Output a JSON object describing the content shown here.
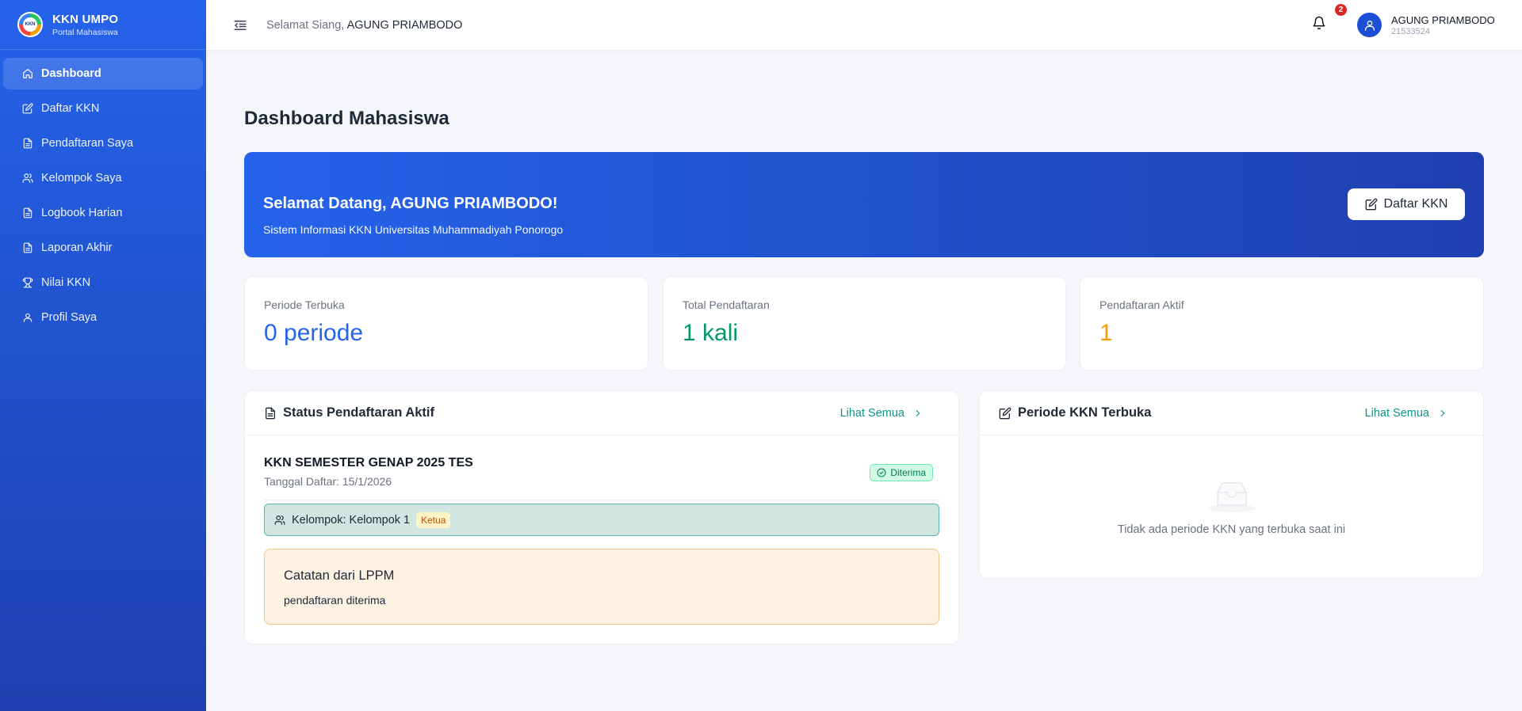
{
  "brand": {
    "title": "KKN UMPO",
    "subtitle": "Portal Mahasiswa",
    "logo_text": "KKN"
  },
  "sidebar": {
    "items": [
      {
        "label": "Dashboard",
        "icon": "home-icon",
        "active": true
      },
      {
        "label": "Daftar KKN",
        "icon": "edit-icon"
      },
      {
        "label": "Pendaftaran Saya",
        "icon": "document-icon"
      },
      {
        "label": "Kelompok Saya",
        "icon": "users-icon"
      },
      {
        "label": "Logbook Harian",
        "icon": "document-icon"
      },
      {
        "label": "Laporan Akhir",
        "icon": "document-icon"
      },
      {
        "label": "Nilai KKN",
        "icon": "trophy-icon"
      },
      {
        "label": "Profil Saya",
        "icon": "user-icon"
      }
    ]
  },
  "header": {
    "greeting_prefix": "Selamat Siang, ",
    "greeting_name": "AGUNG PRIAMBODO",
    "notification_count": "2",
    "user_name": "AGUNG PRIAMBODO",
    "user_id": "21533524"
  },
  "main": {
    "page_title": "Dashboard Mahasiswa",
    "hero": {
      "title": "Selamat Datang, AGUNG PRIAMBODO!",
      "subtitle": "Sistem Informasi KKN Universitas Muhammadiyah Ponorogo",
      "button_label": "Daftar KKN"
    },
    "stats": [
      {
        "label": "Periode Terbuka",
        "value": "0",
        "unit": "periode",
        "color": "#2563eb"
      },
      {
        "label": "Total Pendaftaran",
        "value": "1",
        "unit": "kali",
        "color": "#059669"
      },
      {
        "label": "Pendaftaran Aktif",
        "value": "1",
        "unit": "",
        "color": "#f59e0b"
      }
    ],
    "status_card": {
      "title": "Status Pendaftaran Aktif",
      "see_all": "Lihat Semua",
      "registration_name": "KKN SEMESTER GENAP 2025 TES",
      "registration_date": "Tanggal Daftar: 15/1/2026",
      "status_badge": "Diterima",
      "group_label": "Kelompok: Kelompok 1",
      "role_tag": "Ketua",
      "note_title": "Catatan dari LPPM",
      "note_text": "pendaftaran diterima"
    },
    "period_card": {
      "title": "Periode KKN Terbuka",
      "see_all": "Lihat Semua",
      "empty_text": "Tidak ada periode KKN yang terbuka saat ini"
    }
  }
}
